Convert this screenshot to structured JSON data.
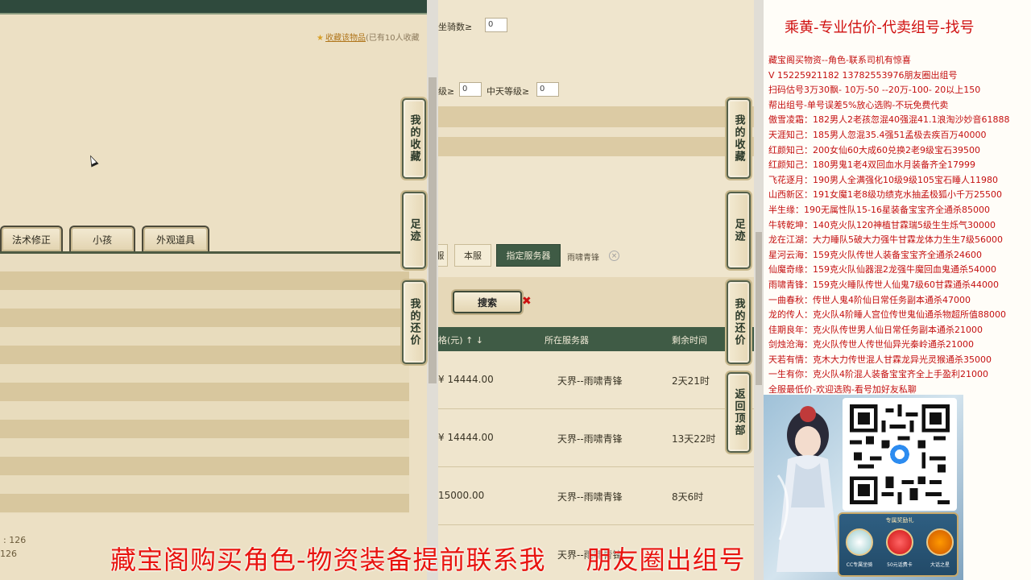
{
  "left": {
    "fav_link": "收藏该物品",
    "fav_count": "(已有10人收藏",
    "tabs": [
      "法术修正",
      "小孩",
      "外观道具"
    ],
    "nums": [
      ": 126",
      "126"
    ]
  },
  "side_buttons": {
    "fav": "我的收藏",
    "footprint": "足迹",
    "bargain": "我的还价",
    "back_top": "返回顶部"
  },
  "mid": {
    "filter1_label": "坐骑数≥",
    "filter1_value": "0",
    "filter2_label": "级≥",
    "filter2_value": "0",
    "filter3_label": "中天等级≥",
    "filter3_value": "0",
    "server_tabs": {
      "prev": "服",
      "local": "本服",
      "specify": "指定服务器",
      "selected_server": "雨啸青锋",
      "clear": "×"
    },
    "search_label": "搜索",
    "search_mark": "✖",
    "table": {
      "headers": [
        "格(元) ↑ ↓",
        "所在服务器",
        "剩余时间"
      ],
      "rows": [
        {
          "price": "¥ 14444.00",
          "server": "天界--雨啸青锋",
          "time": "2天21时"
        },
        {
          "price": "¥ 14444.00",
          "server": "天界--雨啸青锋",
          "time": "13天22时"
        },
        {
          "price": "15000.00",
          "server": "天界--雨啸青锋",
          "time": "8天6时"
        },
        {
          "price": "",
          "server": "天界--雨啸青锋",
          "time": ""
        }
      ]
    }
  },
  "ad": {
    "title": "乘黄-专业估价-代卖组号-找号",
    "lines": [
      "藏宝阁买物资--角色-联系司机有惊喜",
      "V 15225921182 13782553976朋友圈出组号",
      "扫码估号3万30飘- 10万-50 --20万-100- 20以上150",
      "帮出组号-单号误差5%放心选购-不玩免费代卖",
      "傲雪凌霜：182男人2老孩忽混40强混41.1浪淘沙妙音61888",
      "天涯知己：185男人忽混35.4强51孟极去疾百万40000",
      "红颜知己：200女仙60大成60兑换2老9级宝石39500",
      "红颜知己：180男鬼1老4双回血水月装备齐全17999",
      "飞花逐月：190男人全满强化10级9级105宝石睡人11980",
      "山西新区：191女魔1老8级功绩克水抽孟极狐小千万25500",
      "半生缘：190无属性队15-16星装备宝宝齐全通杀85000",
      "牛转乾坤：140克火队120神植甘霖瑞5级生生烁气30000",
      "龙在江湖：大力睡队5破大力强牛甘霖龙体力生生7级56000",
      "星河云海：159克火队传世人装备宝宝齐全通杀24600",
      "仙魔奇缘：159克火队仙器混2龙强牛魔回血鬼通杀54000",
      "雨啸青锋：159克火睡队传世人仙鬼7级60甘霖通杀44000",
      "一曲春秋：传世人鬼4阶仙日常任务副本通杀47000",
      "龙的传人：克火队4阶睡人宫位传世鬼仙通杀物超所值88000",
      "佳期良年：克火队传世男人仙日常任务副本通杀21000",
      "剑烛沧海：克火队传世人传世仙异光秦岭通杀21000",
      "天若有情：克木大力传世混人甘霖龙异光灵猴通杀35000",
      "一生有你：克火队4阶混人装备宝宝齐全上手盈利21000",
      "全服最低价-欢迎选购-看号加好友私聊"
    ],
    "promo_title": "专属奖励礼",
    "promo_caps": [
      "CC专属坐骑",
      "50元话费卡",
      "大话之星"
    ]
  },
  "caption": {
    "part1": "藏宝阁购买角色-物资装备提前联系我",
    "part2": "朋友圈出组号"
  },
  "colors": {
    "ad_text": "#c41010",
    "caption": "#e8140f",
    "table_header": "#3f5b45"
  }
}
